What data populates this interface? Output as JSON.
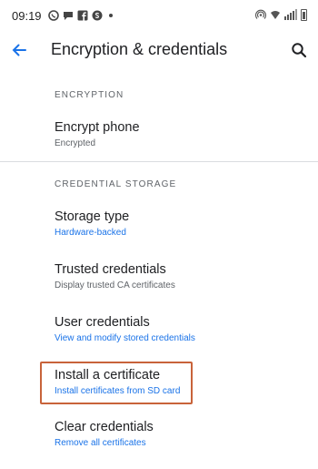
{
  "status_bar": {
    "time": "09:19",
    "left_icons": [
      "whatsapp-icon",
      "chat-bubble-icon",
      "facebook-icon",
      "skype-icon"
    ],
    "right_icons": [
      "hotspot-icon",
      "wifi-icon",
      "signal-icon",
      "battery-icon"
    ]
  },
  "toolbar": {
    "title": "Encryption & credentials",
    "back_icon": "arrow-left-icon",
    "search_icon": "search-icon"
  },
  "sections": {
    "encryption": {
      "header": "ENCRYPTION",
      "items": [
        {
          "title": "Encrypt phone",
          "subtitle": "Encrypted"
        }
      ]
    },
    "credential_storage": {
      "header": "CREDENTIAL STORAGE",
      "items": [
        {
          "title": "Storage type",
          "subtitle": "Hardware-backed"
        },
        {
          "title": "Trusted credentials",
          "subtitle": "Display trusted CA certificates"
        },
        {
          "title": "User credentials",
          "subtitle": "View and modify stored credentials"
        },
        {
          "title": "Install a certificate",
          "subtitle": "Install certificates from SD card"
        },
        {
          "title": "Clear credentials",
          "subtitle": "Remove all certificates"
        }
      ]
    }
  },
  "colors": {
    "accent": "#1a73e8",
    "highlight": "#c8633a"
  }
}
